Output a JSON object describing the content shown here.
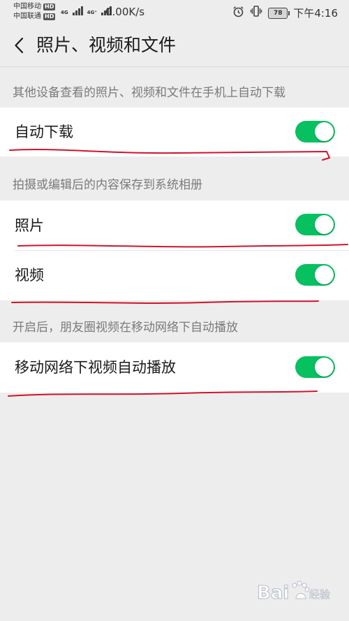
{
  "status_bar": {
    "carrier1": "中国移动",
    "carrier2": "中国联通",
    "hd": "HD",
    "net1": "4G",
    "net2": "4G⁺",
    "speed": "0.00K/s",
    "battery": "78",
    "time": "下午4:16"
  },
  "nav": {
    "title": "照片、视频和文件"
  },
  "sections": [
    {
      "label": "其他设备查看的照片、视频和文件在手机上自动下载",
      "rows": [
        {
          "label": "自动下载",
          "enabled": true
        }
      ]
    },
    {
      "label": "拍摄或编辑后的内容保存到系统相册",
      "rows": [
        {
          "label": "照片",
          "enabled": true
        },
        {
          "label": "视频",
          "enabled": true
        }
      ]
    },
    {
      "label": "开启后，朋友圈视频在移动网络下自动播放",
      "rows": [
        {
          "label": "移动网络下视频自动播放",
          "enabled": true
        }
      ]
    }
  ],
  "colors": {
    "toggle_on": "#07c160",
    "annotation": "#d0142c"
  },
  "watermark": {
    "brand": "Bai",
    "logo_text": "Baidu经验"
  }
}
